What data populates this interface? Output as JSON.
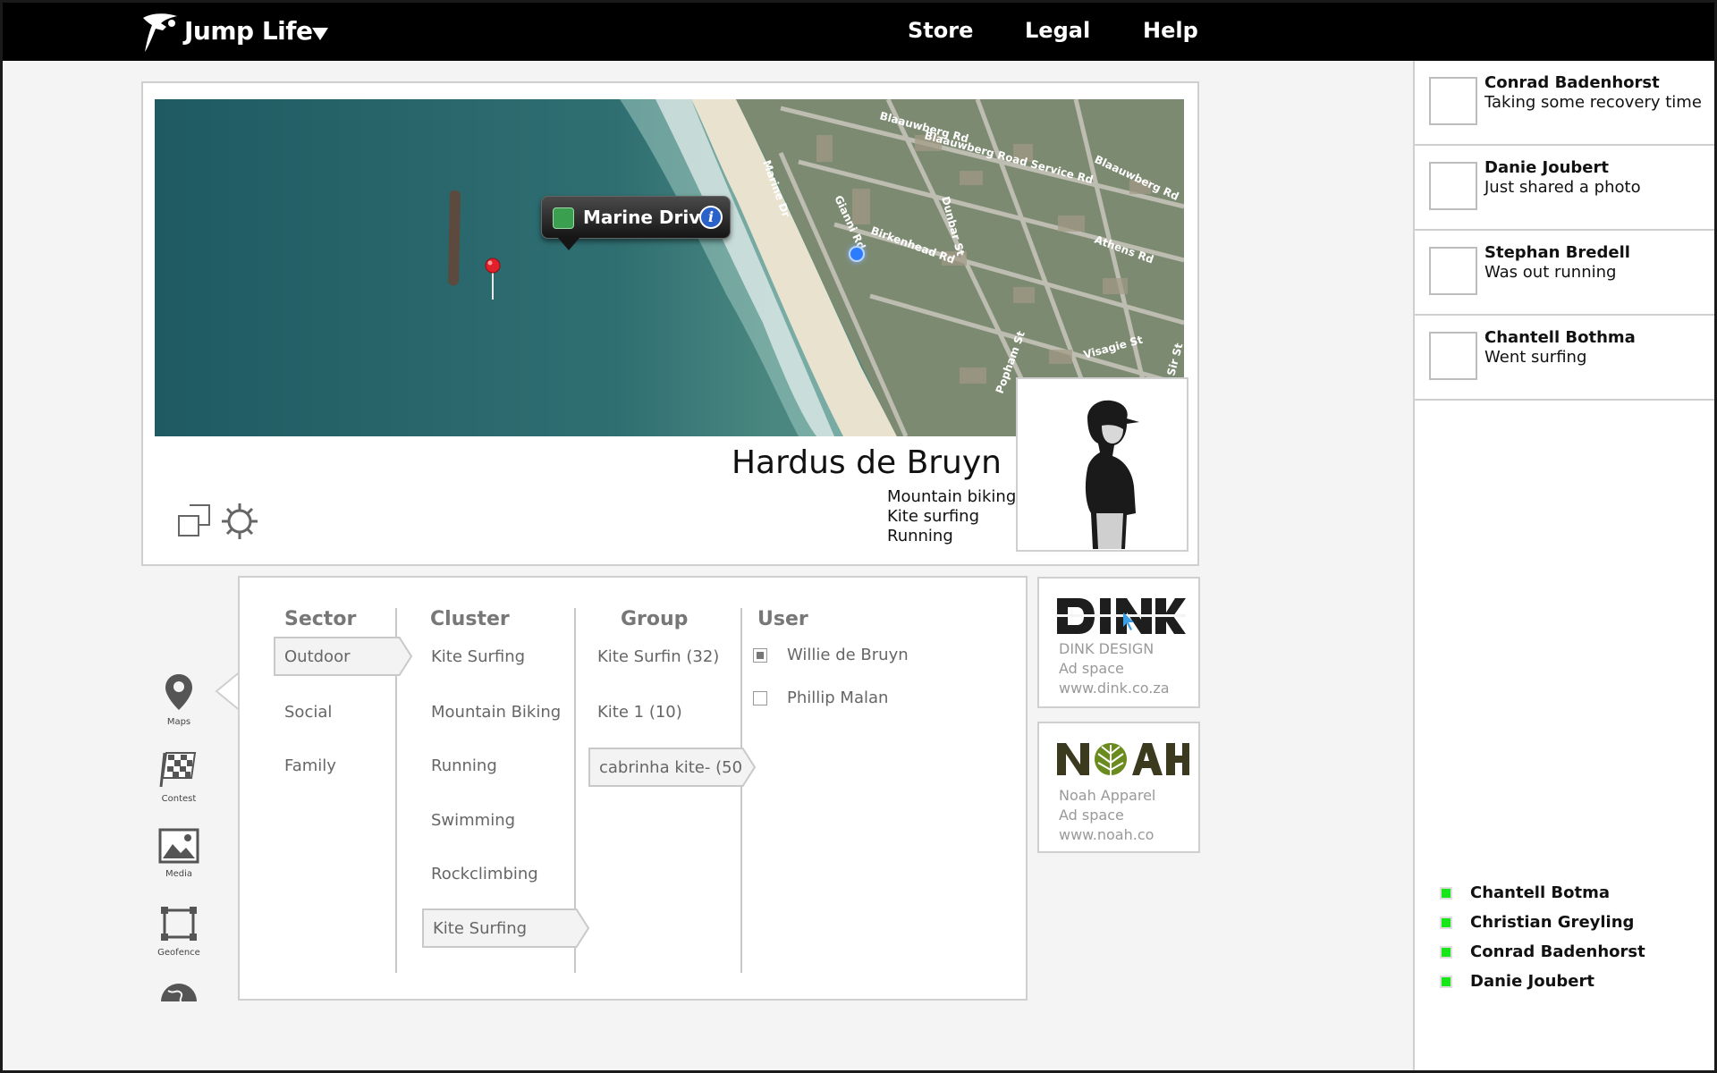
{
  "app": {
    "brand": "Jump Life",
    "nav": {
      "store": "Store",
      "legal": "Legal",
      "help": "Help"
    }
  },
  "profile": {
    "name": "Hardus de Bruyn",
    "activities": [
      "Mountain biking",
      "Kite surfing",
      "Running"
    ],
    "map": {
      "callout": "Marine Drive",
      "streets": [
        "Blaauwberg Rd",
        "Blaauwberg Road Service Rd",
        "Blaauwberg Rd",
        "Marine Dr",
        "Gianni Rd",
        "Birkenhead Rd",
        "Dunbar St",
        "Athens Rd",
        "Popham St",
        "Visagie St",
        "Sir St"
      ]
    }
  },
  "rail": {
    "maps": "Maps",
    "contest": "Contest",
    "media": "Media",
    "geofence": "Geofence"
  },
  "browser": {
    "headers": {
      "sector": "Sector",
      "cluster": "Cluster",
      "group": "Group",
      "user": "User"
    },
    "sector": [
      "Outdoor",
      "Social",
      "Family"
    ],
    "cluster": [
      "Kite Surfing",
      "Mountain Biking",
      "Running",
      "Swimming",
      "Rockclimbing",
      "Kite Surfing"
    ],
    "group": [
      "Kite Surfin (32)",
      "Kite 1 (10)",
      "cabrinha kite- (50)"
    ],
    "users": [
      "Willie de Bruyn",
      "Phillip Malan"
    ]
  },
  "ads": [
    {
      "logo": "DINK",
      "line1": "DINK DESIGN",
      "line2": "Ad space",
      "line3": "www.dink.co.za"
    },
    {
      "logo": "NOAH",
      "line1": "Noah Apparel",
      "line2": "Ad space",
      "line3": "www.noah.co"
    }
  ],
  "feed": [
    {
      "name": "Conrad Badenhorst",
      "status": "Taking some recovery time"
    },
    {
      "name": "Danie Joubert",
      "status": "Just shared a photo"
    },
    {
      "name": "Stephan Bredell",
      "status": "Was out running"
    },
    {
      "name": "Chantell Bothma",
      "status": "Went surfing"
    }
  ],
  "online": [
    "Chantell Botma",
    "Christian Greyling",
    "Conrad Badenhorst",
    "Danie Joubert"
  ],
  "colors": {
    "nav": "#000000",
    "online": "#19e619",
    "ocean": "#2e6a6e",
    "noah": "#3c3a1e"
  }
}
